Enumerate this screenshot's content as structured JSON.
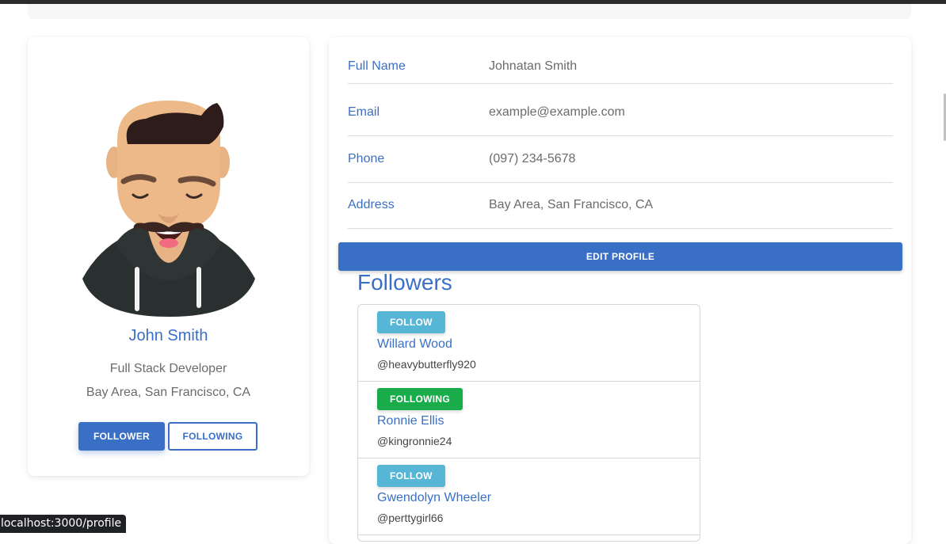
{
  "profile": {
    "name": "John Smith",
    "role": "Full Stack Developer",
    "location": "Bay Area, San Francisco, CA",
    "follower_label": "FOLLOWER",
    "following_label": "FOLLOWING"
  },
  "details": [
    {
      "label": "Full Name",
      "value": "Johnatan Smith"
    },
    {
      "label": "Email",
      "value": "example@example.com"
    },
    {
      "label": "Phone",
      "value": "(097) 234-5678"
    },
    {
      "label": "Address",
      "value": "Bay Area, San Francisco, CA"
    }
  ],
  "edit_label": "EDIT PROFILE",
  "followers": {
    "title": "Followers",
    "items": [
      {
        "button": "FOLLOW",
        "name": "Willard Wood",
        "handle": "@heavybutterfly920"
      },
      {
        "button": "FOLLOWING",
        "name": "Ronnie Ellis",
        "handle": "@kingronnie24"
      },
      {
        "button": "FOLLOW",
        "name": "Gwendolyn Wheeler",
        "handle": "@perttygirl66"
      }
    ]
  },
  "status_url": "localhost:3000/profile",
  "colors": {
    "primary": "#3a6fc6",
    "follow": "#57b6d6",
    "following": "#1aab4b"
  }
}
